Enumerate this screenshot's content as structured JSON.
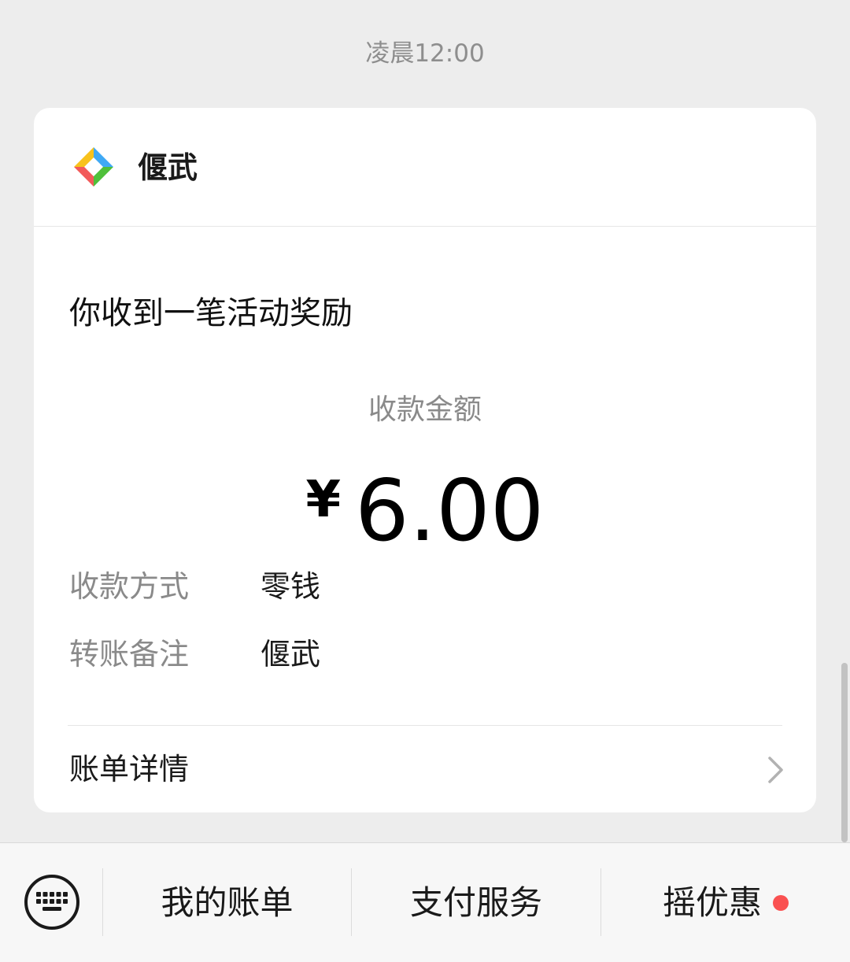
{
  "message": {
    "timestamp": "凌晨12:00"
  },
  "card": {
    "sender_name": "偃武",
    "sender_logo_icon": "wechat-pay-logo-icon",
    "title": "你收到一笔活动奖励",
    "amount_label": "收款金额",
    "currency_symbol": "¥",
    "amount": "6.00",
    "details": [
      {
        "label": "收款方式",
        "value": "零钱"
      },
      {
        "label": "转账备注",
        "value": "偃武"
      }
    ],
    "bill_link_label": "账单详情",
    "bill_link_icon": "chevron-right-icon"
  },
  "bottom_menu": {
    "keyboard_icon": "keyboard-icon",
    "items": [
      {
        "label": "我的账单"
      },
      {
        "label": "支付服务"
      },
      {
        "label": "摇优惠",
        "has_badge": true
      }
    ],
    "badge_color": "#fa5151"
  },
  "colors": {
    "background": "#ededed",
    "card": "#ffffff",
    "secondary_text": "#8a8a8a",
    "primary_text": "#1a1a1a"
  }
}
